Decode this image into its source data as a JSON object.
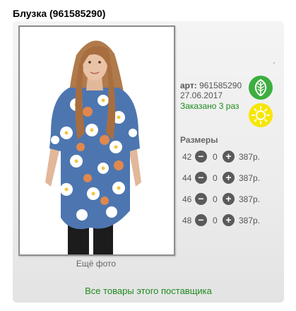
{
  "product": {
    "title": "Блузка (961585290)",
    "more_photo": "Ещё фото",
    "art_label": "арт:",
    "art_value": "961585290",
    "date": "27.06.2017",
    "ordered": "Заказано 3 раз",
    "supplier_link": "Все товары этого поставщика"
  },
  "sizes": {
    "title": "Размеры",
    "rows": [
      {
        "size": "42",
        "qty": "0",
        "price": "387р."
      },
      {
        "size": "44",
        "qty": "0",
        "price": "387р."
      },
      {
        "size": "46",
        "qty": "0",
        "price": "387р."
      },
      {
        "size": "48",
        "qty": "0",
        "price": "387р."
      }
    ]
  },
  "colors": {
    "link_green": "#1e8b1e",
    "leaf_badge": "#3dae3f",
    "sun_badge": "#f7e600"
  },
  "icons": {
    "leaf": "leaf-icon",
    "sun": "sun-icon",
    "minus": "minus-icon",
    "plus": "plus-icon"
  }
}
